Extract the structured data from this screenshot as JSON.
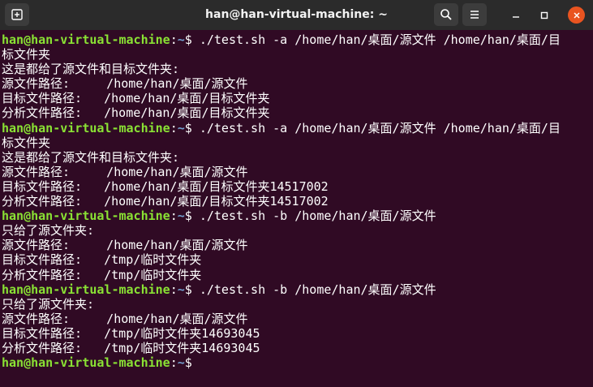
{
  "window": {
    "title": "han@han-virtual-machine: ~"
  },
  "titlebar": {
    "new_tab_icon": "new-tab-icon",
    "search_icon": "search-icon",
    "menu_icon": "hamburger-menu-icon",
    "minimize_icon": "minimize-icon",
    "maximize_icon": "maximize-icon",
    "close_icon": "close-icon",
    "close_color": "#e95420"
  },
  "colors": {
    "background": "#300a24",
    "prompt_user": "#8ae234",
    "prompt_path": "#729fcf",
    "text": "#ffffff"
  },
  "terminal": {
    "lines": [
      {
        "type": "prompt",
        "user": "han@han-virtual-machine",
        "path": "~",
        "symbol": "$",
        "command": " ./test.sh -a /home/han/桌面/源文件 /home/han/桌面/目"
      },
      {
        "type": "output",
        "text": "标文件夹"
      },
      {
        "type": "output",
        "text": "这是都给了源文件和目标文件夹:"
      },
      {
        "type": "output",
        "text": "源文件路径:     /home/han/桌面/源文件"
      },
      {
        "type": "output",
        "text": "目标文件路径:   /home/han/桌面/目标文件夹"
      },
      {
        "type": "output",
        "text": "分析文件路径:   /home/han/桌面/目标文件夹"
      },
      {
        "type": "prompt",
        "user": "han@han-virtual-machine",
        "path": "~",
        "symbol": "$",
        "command": " ./test.sh -a /home/han/桌面/源文件 /home/han/桌面/目"
      },
      {
        "type": "output",
        "text": "标文件夹"
      },
      {
        "type": "output",
        "text": "这是都给了源文件和目标文件夹:"
      },
      {
        "type": "output",
        "text": "源文件路径:     /home/han/桌面/源文件"
      },
      {
        "type": "output",
        "text": "目标文件路径:   /home/han/桌面/目标文件夹14517002"
      },
      {
        "type": "output",
        "text": "分析文件路径:   /home/han/桌面/目标文件夹14517002"
      },
      {
        "type": "prompt",
        "user": "han@han-virtual-machine",
        "path": "~",
        "symbol": "$",
        "command": " ./test.sh -b /home/han/桌面/源文件"
      },
      {
        "type": "output",
        "text": "只给了源文件夹:"
      },
      {
        "type": "output",
        "text": "源文件路径:     /home/han/桌面/源文件"
      },
      {
        "type": "output",
        "text": "目标文件路径:   /tmp/临时文件夹"
      },
      {
        "type": "output",
        "text": "分析文件路径:   /tmp/临时文件夹"
      },
      {
        "type": "prompt",
        "user": "han@han-virtual-machine",
        "path": "~",
        "symbol": "$",
        "command": " ./test.sh -b /home/han/桌面/源文件"
      },
      {
        "type": "output",
        "text": "只给了源文件夹:"
      },
      {
        "type": "output",
        "text": "源文件路径:     /home/han/桌面/源文件"
      },
      {
        "type": "output",
        "text": "目标文件路径:   /tmp/临时文件夹14693045"
      },
      {
        "type": "output",
        "text": "分析文件路径:   /tmp/临时文件夹14693045"
      },
      {
        "type": "prompt",
        "user": "han@han-virtual-machine",
        "path": "~",
        "symbol": "$",
        "command": " "
      }
    ]
  }
}
